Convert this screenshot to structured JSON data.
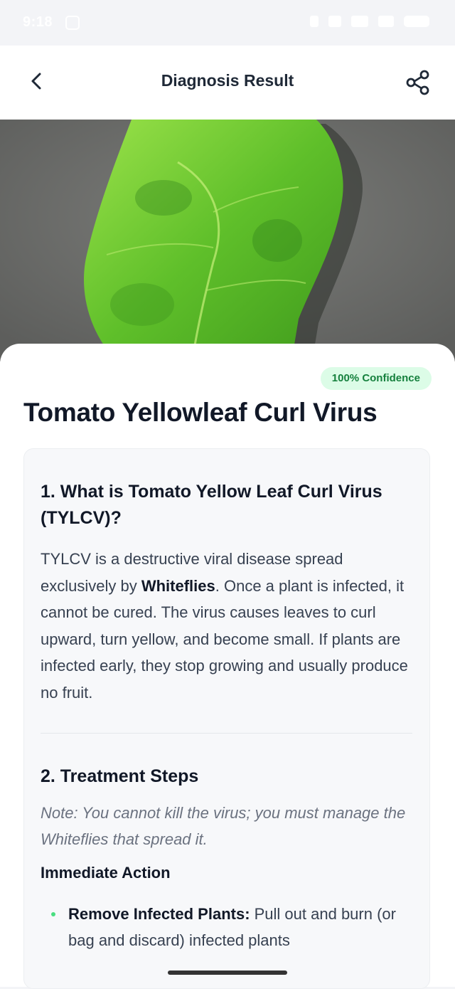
{
  "status_bar": {
    "time": "9:18"
  },
  "header": {
    "title": "Diagnosis Result"
  },
  "result": {
    "confidence": "100% Confidence",
    "disease_name": "Tomato Yellowleaf Curl Virus"
  },
  "section1": {
    "heading": "1. What is Tomato Yellow Leaf Curl Virus (TYLCV)?",
    "body_pre": "TYLCV is a destructive viral disease spread exclusively by ",
    "body_bold": "Whiteflies",
    "body_post": ". Once a plant is infected, it cannot be cured. The virus causes leaves to curl upward, turn yellow, and become small. If plants are infected early, they stop growing and usually produce no fruit."
  },
  "section2": {
    "heading": "2. Treatment Steps",
    "note": "Note: You cannot kill the virus; you must manage the Whiteflies that spread it.",
    "subheading": "Immediate Action",
    "bullets": [
      {
        "bold": "Remove Infected Plants:",
        "text": " Pull out and burn (or bag and discard) infected plants"
      }
    ]
  }
}
